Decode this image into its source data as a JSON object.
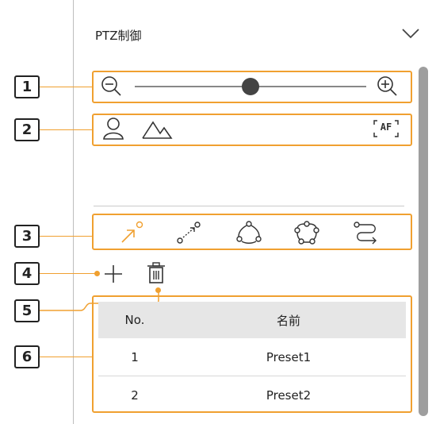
{
  "panel": {
    "title": "PTZ制御"
  },
  "callouts": [
    "1",
    "2",
    "3",
    "4",
    "5",
    "6"
  ],
  "colors": {
    "highlight": "#f0a030",
    "scrollbar": "#9e9e9e",
    "header_bg": "#e6e6e6"
  },
  "zoom": {
    "level": 0.5
  },
  "icons": {
    "zoom_out": "zoom-out-icon",
    "zoom_in": "zoom-in-icon",
    "face": "face-icon",
    "landscape": "landscape-icon",
    "af": "AF",
    "preset": "preset-icon",
    "swing": "swing-icon",
    "group": "group-icon",
    "tour": "tour-icon",
    "trace": "trace-icon",
    "add": "add-icon",
    "delete": "trash-icon"
  },
  "table": {
    "headers": [
      "No.",
      "名前"
    ],
    "rows": [
      {
        "no": "1",
        "name": "Preset1"
      },
      {
        "no": "2",
        "name": "Preset2"
      }
    ]
  }
}
